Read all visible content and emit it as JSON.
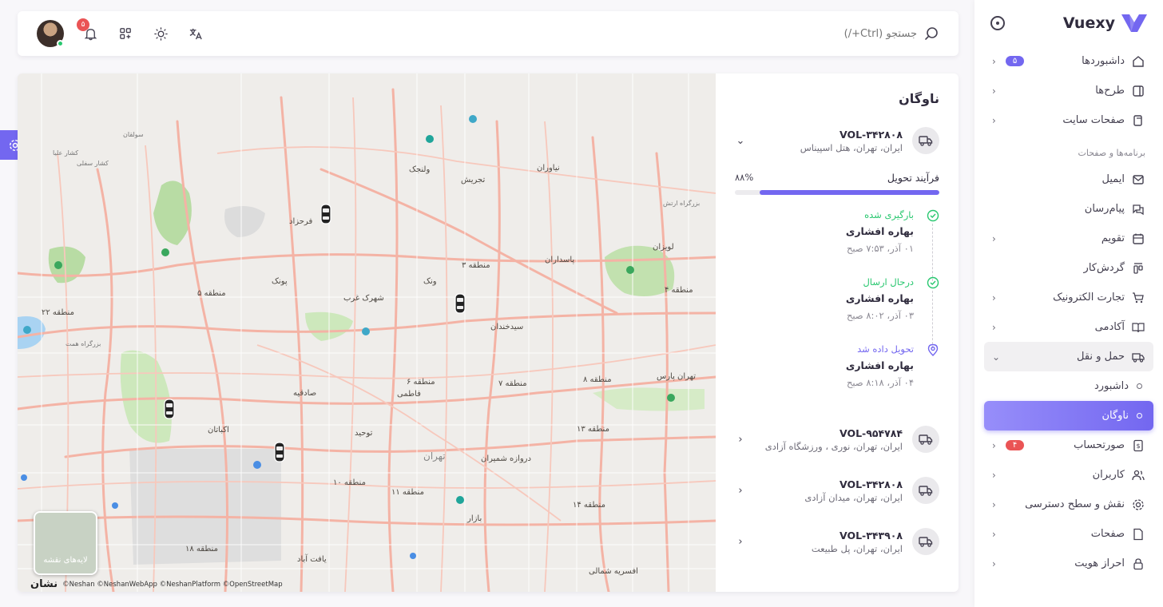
{
  "app": {
    "brand": "Vuexy",
    "brand_color": "#7367f0"
  },
  "navbar": {
    "search_placeholder": "جستجو (Ctrl+/)",
    "notifications_count": "۵",
    "icons": [
      "bell-icon",
      "shortcuts-icon",
      "sun-icon",
      "translate-icon"
    ]
  },
  "sidebar": {
    "items": [
      {
        "label": "داشبوردها",
        "badge": "۵"
      },
      {
        "label": "طرح‌ها"
      },
      {
        "label": "صفحات سایت"
      }
    ],
    "section_header": "برنامه‌ها و صفحات",
    "apps": [
      {
        "label": "ایمیل"
      },
      {
        "label": "پیام‌رسان"
      },
      {
        "label": "تقویم"
      },
      {
        "label": "گردش‌کار"
      },
      {
        "label": "تجارت الکترونیک"
      },
      {
        "label": "آکادمی"
      },
      {
        "label": "حمل و نقل"
      }
    ],
    "logistics_sub": [
      {
        "label": "داشبورد"
      },
      {
        "label": "ناوگان"
      }
    ],
    "more": [
      {
        "label": "صورتحساب",
        "badge": "۴"
      },
      {
        "label": "کاربران"
      },
      {
        "label": "نقش و سطح دسترسی"
      },
      {
        "label": "صفحات"
      },
      {
        "label": "احراز هویت"
      }
    ]
  },
  "fleet": {
    "title": "ناوگان",
    "vehicles": [
      {
        "id": "VOL-۳۴۲۸۰۸",
        "location": "ایران، تهران، هتل اسپیناس"
      },
      {
        "id": "VOL-۹۵۴۷۸۴",
        "location": "ایران، تهران، نوری ، ورزشگاه آزادی"
      },
      {
        "id": "VOL-۳۴۲۸۰۸",
        "location": "ایران، تهران، میدان آزادی"
      },
      {
        "id": "VOL-۳۴۳۹۰۸",
        "location": "ایران، تهران، پل طبیعت"
      }
    ],
    "progress_label": "فرآیند تحویل",
    "progress_text": "۸۸%",
    "progress_value": 0.88,
    "timeline": [
      {
        "status": "بارگیری شده",
        "name": "بهاره افشاری",
        "time": "۰۱ آذر، ۷:۵۳ صبح"
      },
      {
        "status": "درحال ارسال",
        "name": "بهاره افشاری",
        "time": "۰۳ آذر، ۸:۰۲ صبح"
      },
      {
        "status": "تحویل داده شد",
        "name": "بهاره افشاری",
        "time": "۰۴ آذر، ۸:۱۸ صبح"
      }
    ]
  },
  "map": {
    "labels": {
      "tehran": "تهران",
      "velenjak": "ولنجک",
      "tajrish": "تجریش",
      "niavaran": "نیاوران",
      "farahzad": "فرحزاد",
      "region3": "منطقه ۳",
      "pasdaran": "پاسداران",
      "lavizan": "لویزان",
      "region5": "منطقه ۵",
      "poonak": "پونک",
      "vanak": "ونک",
      "shahrak": "شهرک غرب",
      "region4": "منطقه ۴",
      "region22": "منطقه ۲۲",
      "seyedkhandan": "سیدخندان",
      "region6": "منطقه ۶",
      "region7": "منطقه ۷",
      "region8": "منطقه ۸",
      "tehranpars": "تهران پارس",
      "sadeghieh": "صادقیه",
      "fatemi": "فاطمی",
      "ekbatan": "اکباتان",
      "tohid": "توحید",
      "region13": "منطقه ۱۳",
      "darvazeh": "دروازه شمیران",
      "region10": "منطقه ۱۰",
      "region11": "منطقه ۱۱",
      "region14": "منطقه ۱۴",
      "bazar": "بازار",
      "region18": "منطقه ۱۸",
      "yaftabad": "یافت آباد",
      "afsarieh": "افسریه شمالی",
      "soleghan": "سولقان",
      "kashar_olya": "کشار علیا",
      "kashar_sofla": "کشار سفلی",
      "autobahn_hemmat": "بزرگراه همت",
      "autobahn_ertesh": "بزرگراه ارتش"
    },
    "layers_label": "لایه‌های نقشه",
    "attribution": "©Neshan ©NeshanWebApp ©NeshanPlatform ©OpenStreetMap",
    "logo_text": "نشان"
  },
  "colors": {
    "accent": "#7367f0",
    "success": "#28c76f",
    "danger": "#ea5455"
  }
}
